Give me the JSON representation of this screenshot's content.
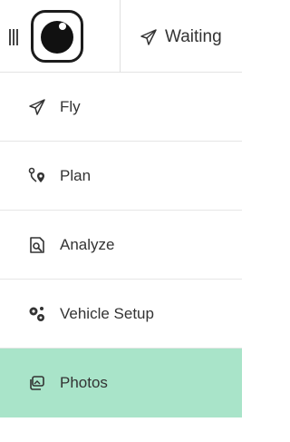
{
  "toolbar": {
    "status_label": "Waiting",
    "status_icon": "paper-plane-icon"
  },
  "menu": {
    "items": [
      {
        "label": "Fly",
        "icon": "paper-plane-icon"
      },
      {
        "label": "Plan",
        "icon": "route-pin-icon"
      },
      {
        "label": "Analyze",
        "icon": "analyze-document-icon"
      },
      {
        "label": "Vehicle Setup",
        "icon": "gears-icon"
      },
      {
        "label": "Photos",
        "icon": "photos-icon",
        "active": true
      }
    ]
  },
  "colors": {
    "active_background": "#a9e4c9",
    "text": "#333333",
    "divider": "#e6e6e6"
  }
}
